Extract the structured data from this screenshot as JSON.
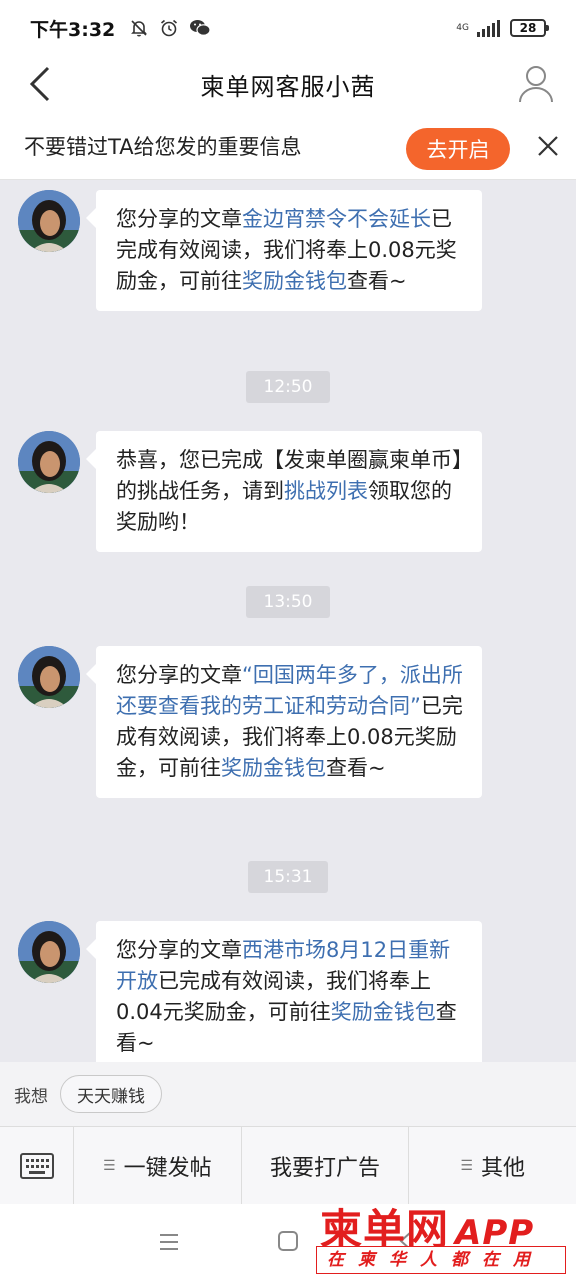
{
  "status_bar": {
    "time": "下午3:32",
    "network": "4G",
    "battery": "28"
  },
  "header": {
    "title": "柬单网客服小茜"
  },
  "notify_bar": {
    "text": "不要错过TA给您发的重要信息",
    "button_label": "去开启"
  },
  "messages": [
    {
      "prefix": "您分享的文章",
      "link1": "金边宵禁令不会延长",
      "mid": "已完成有效阅读，我们将奉上0.08元奖励金，可前往",
      "link2": "奖励金钱包",
      "suffix": "查看~"
    },
    {
      "timestamp": "12:50",
      "prefix": "恭喜，您已完成【发柬单圈赢柬单币】的挑战任务，请到",
      "link1": "挑战列表",
      "mid": "领取您的奖励哟！"
    },
    {
      "timestamp": "13:50",
      "prefix": "您分享的文章",
      "link1": "“回国两年多了，派出所还要查看我的劳工证和劳动合同”",
      "mid": "已完成有效阅读，我们将奉上0.08元奖励金，可前往",
      "link2": "奖励金钱包",
      "suffix": "查看~"
    },
    {
      "timestamp": "15:31",
      "prefix": "您分享的文章",
      "link1": "西港市场8月12日重新开放",
      "mid": "已完成有效阅读，我们将奉上0.04元奖励金，可前往",
      "link2": "奖励金钱包",
      "suffix": "查看~"
    }
  ],
  "suggestion": {
    "label": "我想",
    "chip": "天天赚钱"
  },
  "menu": {
    "item1": "一键发帖",
    "item2": "我要打广告",
    "item3": "其他"
  },
  "watermark": {
    "brand": "柬单网",
    "app": "APP",
    "slogan": "在柬华人都在用"
  },
  "colors": {
    "link": "#3e6fb0",
    "accent_button": "#f4652c",
    "logo_red": "#e21e1e"
  }
}
